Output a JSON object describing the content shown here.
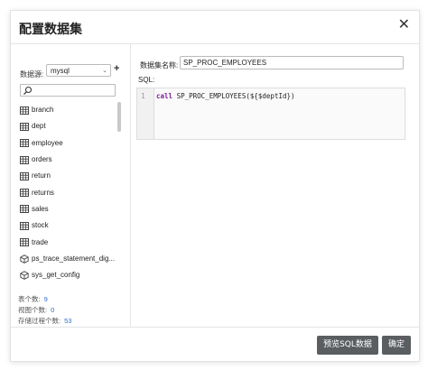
{
  "dialog": {
    "title": "配置数据集",
    "close_icon": "close-icon"
  },
  "datasource": {
    "label": "数据源:",
    "value": "mysql",
    "add_label": "+"
  },
  "search": {
    "placeholder": ""
  },
  "items": [
    {
      "label": "branch",
      "icon": "table-icon"
    },
    {
      "label": "dept",
      "icon": "table-icon"
    },
    {
      "label": "employee",
      "icon": "table-icon"
    },
    {
      "label": "orders",
      "icon": "table-icon"
    },
    {
      "label": "return",
      "icon": "table-icon"
    },
    {
      "label": "returns",
      "icon": "table-icon"
    },
    {
      "label": "sales",
      "icon": "table-icon"
    },
    {
      "label": "stock",
      "icon": "table-icon"
    },
    {
      "label": "trade",
      "icon": "table-icon"
    },
    {
      "label": "ps_trace_statement_dig...",
      "icon": "view-icon"
    },
    {
      "label": "sys_get_config",
      "icon": "view-icon"
    }
  ],
  "stats": {
    "tables_label": "表个数:",
    "tables_count": "9",
    "views_label": "视图个数:",
    "views_count": "0",
    "procs_label": "存储过程个数:",
    "procs_count": "53"
  },
  "dataset": {
    "name_label": "数据集名称:",
    "name_value": "SP_PROC_EMPLOYEES"
  },
  "sql": {
    "label": "SQL:",
    "line_number": "1",
    "keyword": "call",
    "code_rest": " SP_PROC_EMPLOYEES(${$deptId})"
  },
  "footer": {
    "preview_label": "预览SQL数据",
    "ok_label": "确定"
  },
  "colors": {
    "button_bg": "#5b5e61",
    "count_color": "#2f6fc6",
    "keyword_color": "#7a1e9e"
  }
}
